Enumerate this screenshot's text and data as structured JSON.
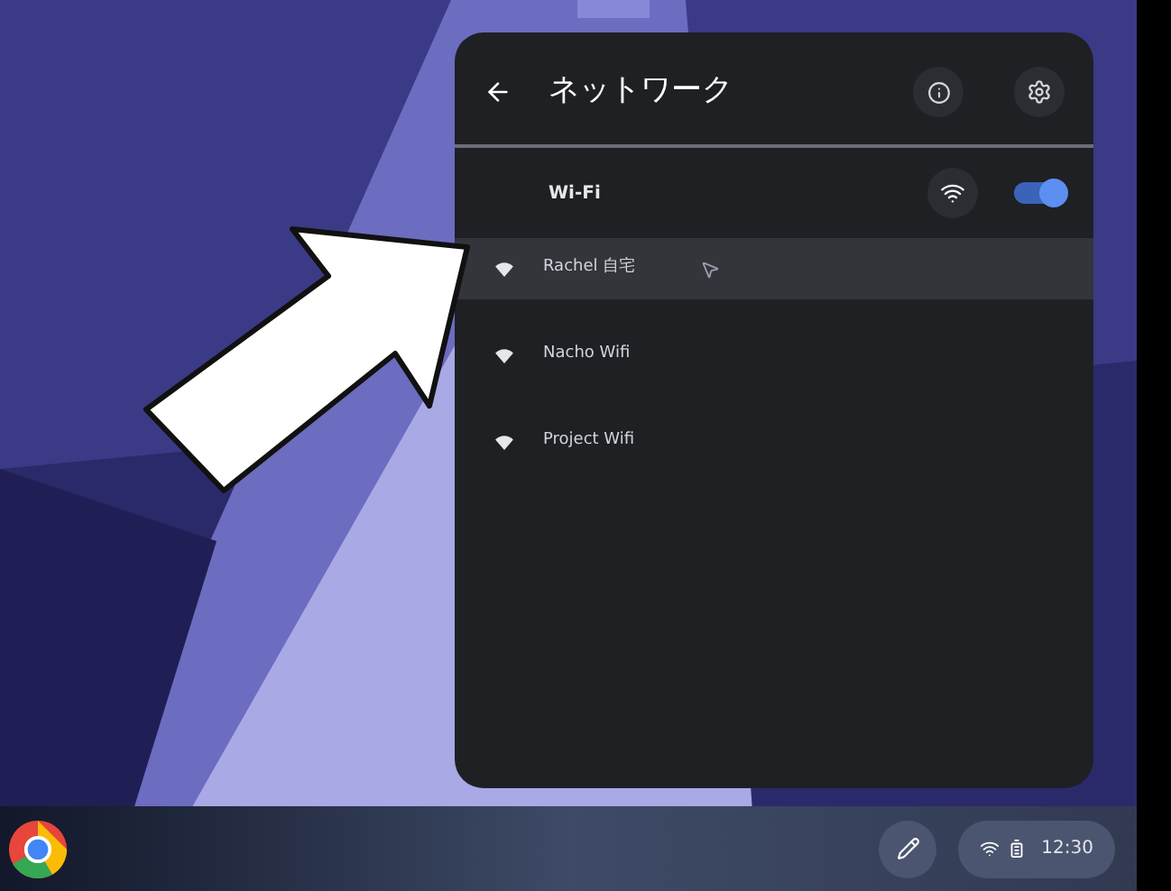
{
  "panel": {
    "title": "ネットワーク",
    "wifi": {
      "label": "Wi-Fi",
      "on": true
    },
    "networks": [
      {
        "name": "Rachel 自宅",
        "selected": true
      },
      {
        "name": "Nacho Wifi",
        "selected": false
      },
      {
        "name": "Project Wifi",
        "selected": false
      }
    ]
  },
  "taskbar": {
    "time": "12:30"
  }
}
